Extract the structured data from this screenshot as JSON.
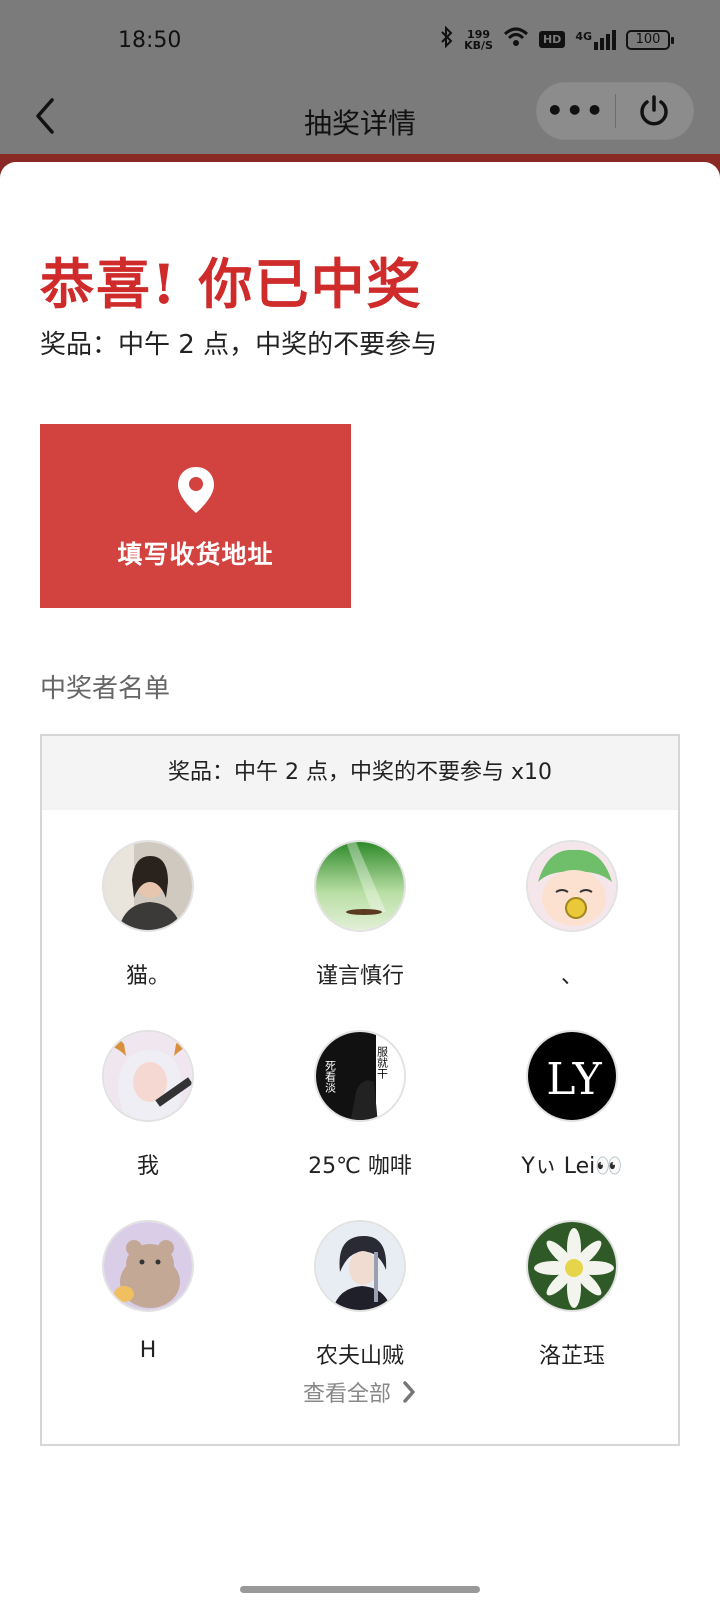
{
  "status_bar": {
    "time": "18:50",
    "net_speed_value": "199",
    "net_speed_unit": "KB/S",
    "hd_label": "HD",
    "signal_label": "4G",
    "battery": "100"
  },
  "nav": {
    "title": "抽奖详情",
    "more_label": "•••"
  },
  "result": {
    "title": "恭喜! 你已中奖",
    "prize_line": "奖品：中午 2 点，中奖的不要参与",
    "address_button": "填写收货地址"
  },
  "winners": {
    "heading": "中奖者名单",
    "box_header": "奖品：中午 2 点，中奖的不要参与 x10",
    "list": [
      {
        "name": "猫。"
      },
      {
        "name": "谨言慎行"
      },
      {
        "name": "、"
      },
      {
        "name": "我"
      },
      {
        "name": "25℃ 咖啡"
      },
      {
        "name": "Yぃ Lei👀"
      },
      {
        "name": "H"
      },
      {
        "name": "农夫山贼"
      },
      {
        "name": "洛芷珏"
      }
    ],
    "view_all": "查看全部",
    "avatar_text_5": "死看淡",
    "avatar_text_5b": "服就干",
    "avatar_text_6": "LY"
  },
  "colors": {
    "accent_red": "#cf2b2b",
    "button_red": "#d24340",
    "overlay_gray": "#7b7b7b"
  }
}
